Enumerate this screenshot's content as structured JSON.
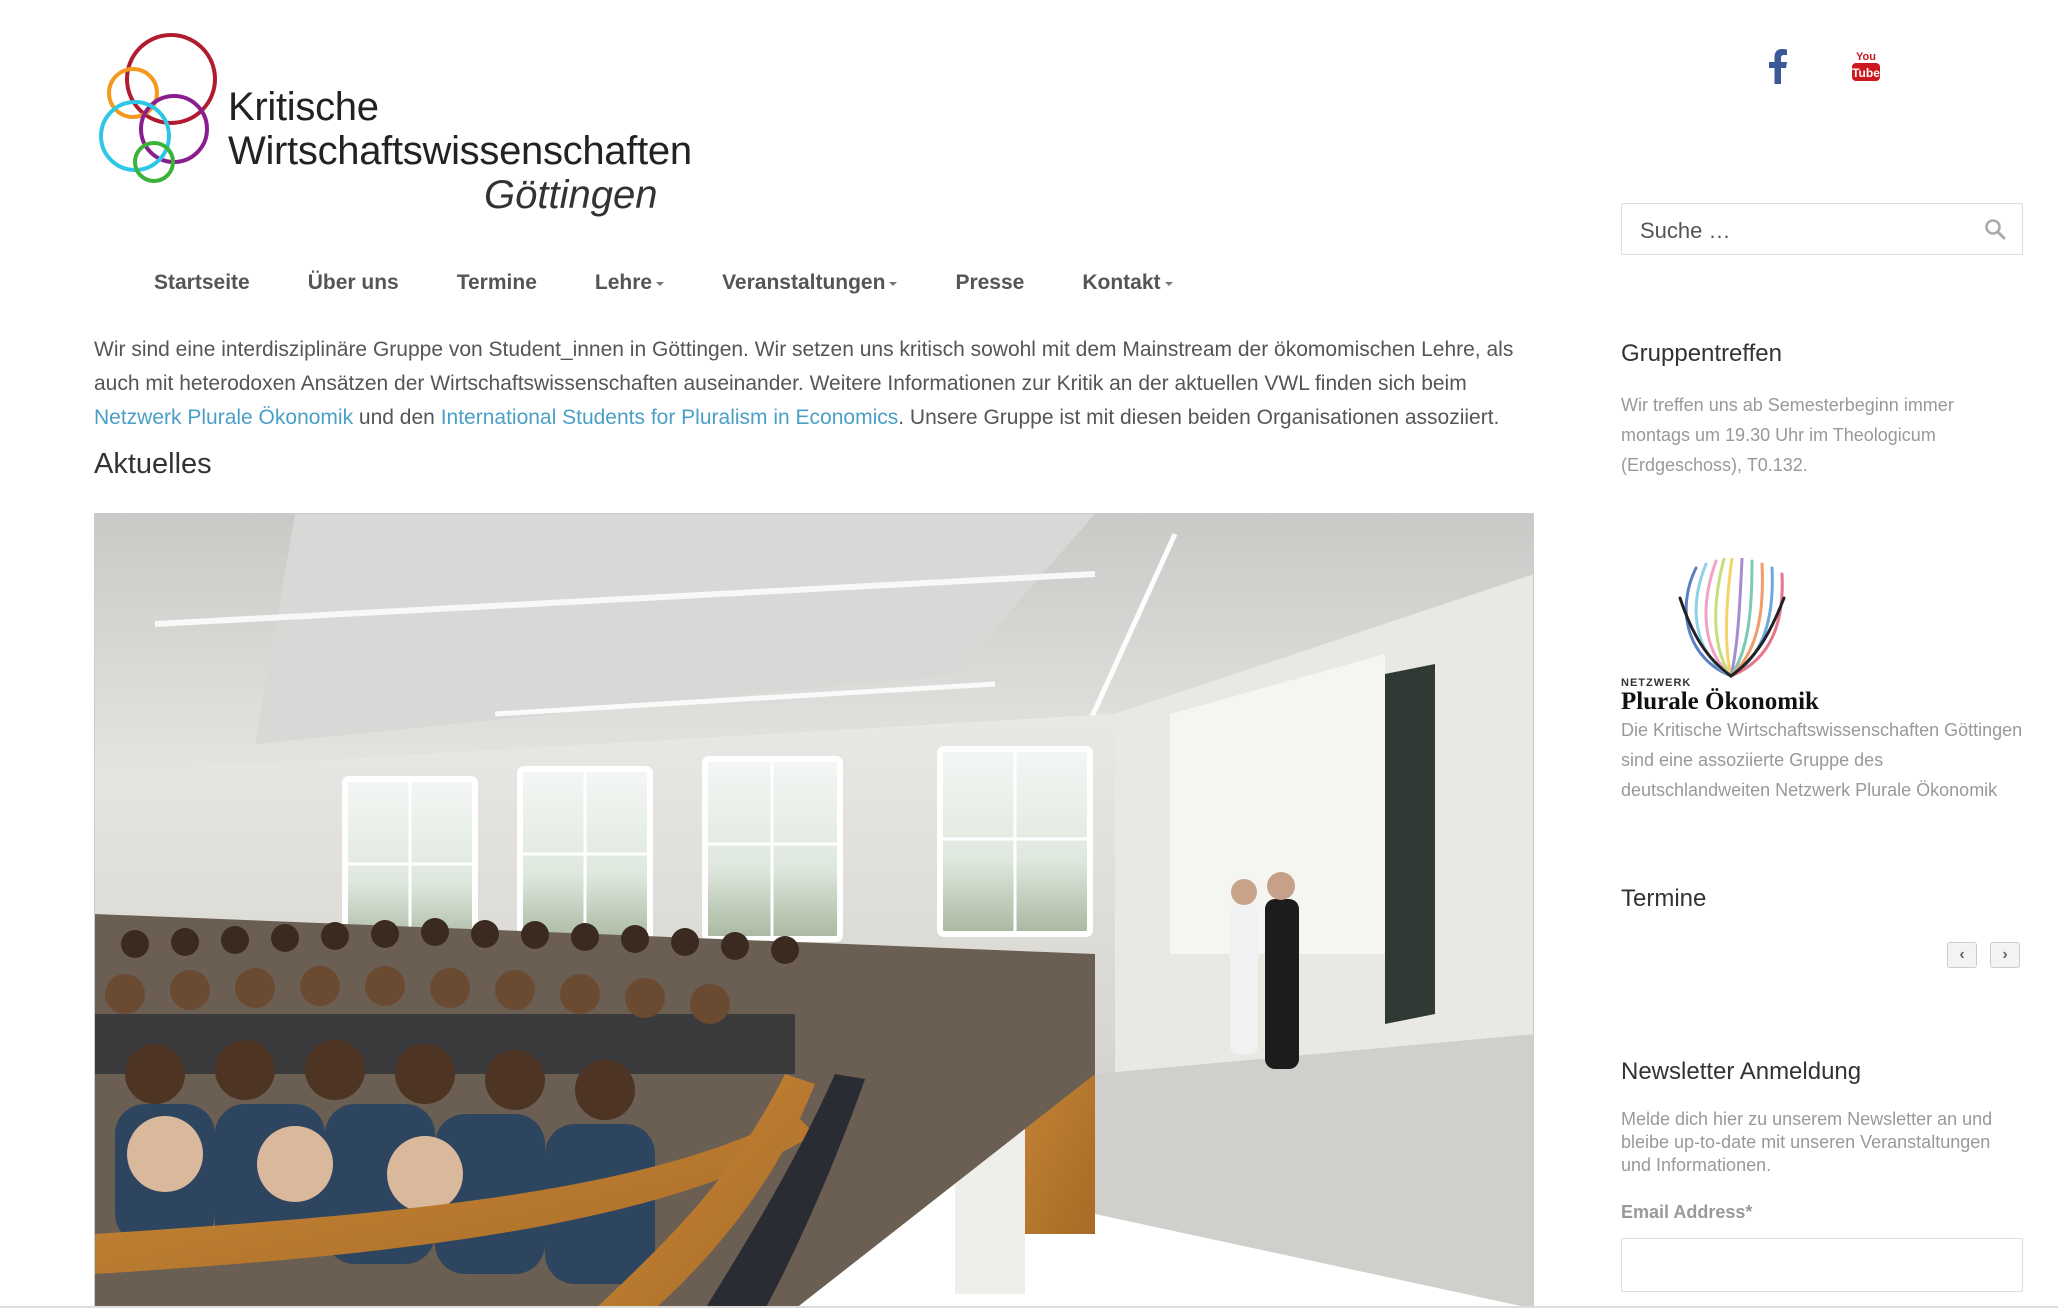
{
  "site": {
    "title_line1": "Kritische",
    "title_line2": "Wirtschaftswissenschaften",
    "title_line3": "Göttingen",
    "logo_colors": [
      "#b01c2e",
      "#f39a1e",
      "#8a1e8f",
      "#2cc7e6",
      "#3bb33b"
    ]
  },
  "social": {
    "facebook_icon": "facebook-icon",
    "facebook_color": "#3b5998",
    "youtube_icon": "youtube-icon",
    "youtube_color": "#cc181e",
    "youtube_text_top": "You",
    "youtube_text_bottom": "Tube"
  },
  "search": {
    "placeholder": "Suche …"
  },
  "nav": {
    "items": [
      {
        "label": "Startseite",
        "dropdown": false
      },
      {
        "label": "Über uns",
        "dropdown": false
      },
      {
        "label": "Termine",
        "dropdown": false
      },
      {
        "label": "Lehre",
        "dropdown": true
      },
      {
        "label": "Veranstaltungen",
        "dropdown": true
      },
      {
        "label": "Presse",
        "dropdown": false
      },
      {
        "label": "Kontakt",
        "dropdown": true
      }
    ]
  },
  "intro": {
    "text_part1": "Wir sind eine interdisziplinäre Gruppe von Student_innen in Göttingen. Wir setzen uns kritisch sowohl mit dem Mainstream der ökomomischen Lehre, als auch mit heterodoxen Ansätzen der Wirtschaftswissenschaften auseinander. Weitere Informationen zur Kritik an der aktuellen VWL finden sich beim ",
    "link1": "Netzwerk Plurale Ökonomik",
    "text_part2": " und den ",
    "link2": "International Students for Pluralism in Economics",
    "text_part3": ". Unsere Gruppe ist mit diesen beiden Organisationen assoziiert.",
    "link_color": "#4a9fc6"
  },
  "main": {
    "heading": "Aktuelles"
  },
  "sidebar": {
    "gruppentreffen": {
      "title": "Gruppentreffen",
      "text": "Wir treffen uns ab Semesterbeginn immer montags um 19.30 Uhr im Theologicum (Erdgeschoss), T0.132."
    },
    "netzwerk": {
      "logo_small": "NETZWERK",
      "logo_large": "Plurale Ökonomik",
      "text": "Die Kritische Wirtschaftswissenschaften Göttingen sind eine assoziierte Gruppe des deutschlandweiten Netzwerk Plurale Ökonomik"
    },
    "termine": {
      "title": "Termine",
      "prev": "‹",
      "next": "›"
    },
    "newsletter": {
      "title": "Newsletter Anmeldung",
      "text": "Melde dich hier zu unserem Newsletter an und bleibe up-to-date mit unseren Veranstaltungen und Informationen.",
      "email_label": "Email Address*"
    }
  }
}
